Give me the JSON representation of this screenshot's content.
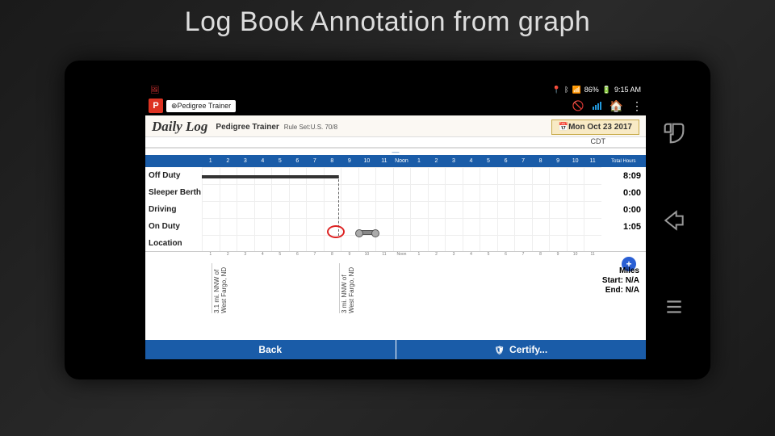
{
  "slide": {
    "title": "Log Book Annotation from graph"
  },
  "statusbar": {
    "time": "9:15 AM",
    "battery": "86%"
  },
  "appbar": {
    "logo": "P",
    "tab": "⊕Pedigree Trainer"
  },
  "header": {
    "title": "Daily Log",
    "subtitle": "Pedigree Trainer",
    "ruleset": "Rule Set:U.S. 70/8",
    "date": "📅Mon Oct 23 2017",
    "timezone": "CDT"
  },
  "timeline": {
    "hours_total_label": "Total Hours",
    "noon_label": "Noon",
    "hours": [
      "1",
      "2",
      "3",
      "4",
      "5",
      "6",
      "7",
      "8",
      "9",
      "10",
      "11",
      "Noon",
      "1",
      "2",
      "3",
      "4",
      "5",
      "6",
      "7",
      "8",
      "9",
      "10",
      "11"
    ]
  },
  "rows": {
    "off_duty": {
      "label": "Off Duty",
      "total": "8:09"
    },
    "sleeper": {
      "label": "Sleeper Berth",
      "total": "0:00"
    },
    "driving": {
      "label": "Driving",
      "total": "0:00"
    },
    "on_duty": {
      "label": "On Duty",
      "total": "1:05"
    },
    "location": {
      "label": "Location"
    }
  },
  "locations": {
    "a": "3.1 mi. NNW of West Fargo, ND",
    "b": "3 mi. NNW of West Fargo, ND"
  },
  "miles": {
    "title": "Miles",
    "start": "Start: N/A",
    "end": "End: N/A"
  },
  "footer": {
    "back": "Back",
    "certify": "Certify..."
  },
  "nav": {
    "back": "↶",
    "home": "⇦",
    "recent": "≡"
  }
}
